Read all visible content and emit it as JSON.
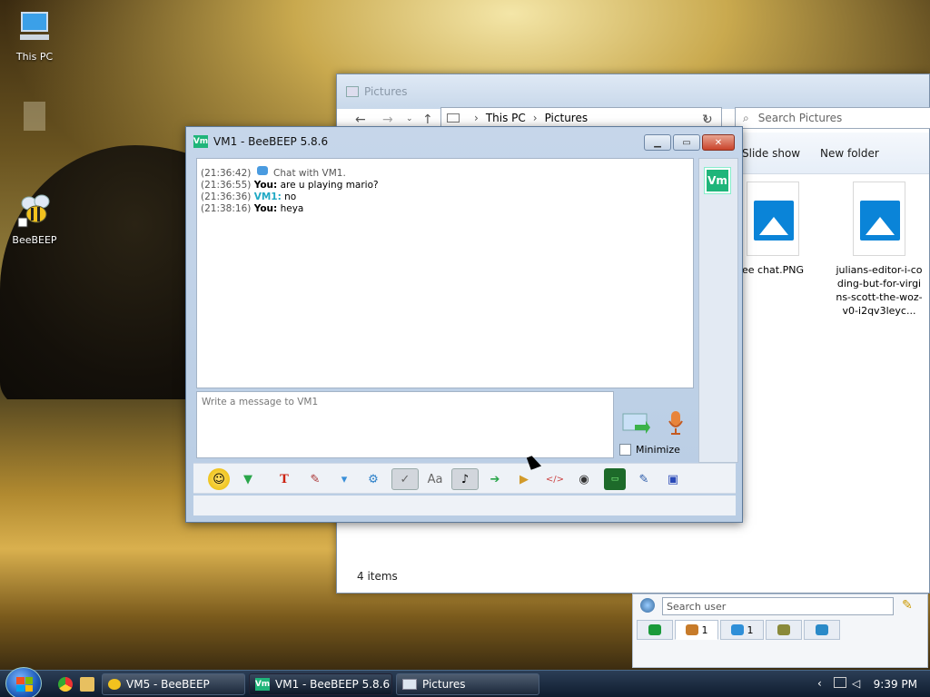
{
  "desktop": {
    "icons": [
      {
        "label": "This PC",
        "icon": "computer-icon"
      },
      {
        "label": "",
        "icon": "folder-icon"
      },
      {
        "label": "BeeBEEP",
        "icon": "bee-icon"
      }
    ]
  },
  "explorer": {
    "title": "Pictures",
    "address": {
      "root": "This PC",
      "current": "Pictures"
    },
    "search_placeholder": "Search Pictures",
    "commands": [
      "Slide show",
      "New folder"
    ],
    "files": [
      {
        "name": "ee chat.PNG"
      },
      {
        "name": "julians-editor-i-coding-but-for-virgins-scott-the-woz-v0-i2qv3leyc..."
      }
    ],
    "status": "4 items"
  },
  "beebeep": {
    "title": "VM1 - BeeBEEP 5.8.6",
    "badge": "Vm",
    "chat": [
      {
        "time": "(21:36:42)",
        "sender": "",
        "text": "Chat with VM1.",
        "system": true
      },
      {
        "time": "(21:36:55)",
        "sender": "You:",
        "text": "are u playing mario?"
      },
      {
        "time": "(21:36:36)",
        "sender": "VM1:",
        "text": "no"
      },
      {
        "time": "(21:38:16)",
        "sender": "You:",
        "text": "heya"
      }
    ],
    "message_placeholder": "Write a message to VM1",
    "minimize_label": "Minimize",
    "toolbar_icons": [
      "emoticon-icon",
      "save-icon",
      "font-icon",
      "color-icon",
      "filter-icon",
      "settings-icon",
      "spellcheck-icon",
      "dictionary-icon",
      "sound-icon",
      "export-icon",
      "send-folder-icon",
      "code-icon",
      "screenshot-icon",
      "shell-icon",
      "notes-icon",
      "save-as-icon"
    ]
  },
  "userlist": {
    "search_placeholder": "Search user",
    "tabs": [
      {
        "icon": "home-icon",
        "count": ""
      },
      {
        "icon": "users-icon",
        "count": "1"
      },
      {
        "icon": "chats-icon",
        "count": "1"
      },
      {
        "icon": "groups-icon",
        "count": ""
      },
      {
        "icon": "network-icon",
        "count": ""
      }
    ]
  },
  "taskbar": {
    "items": [
      {
        "label": "VM5 - BeeBEEP",
        "icon": "bee-icon"
      },
      {
        "label": "VM1 - BeeBEEP 5.8.6",
        "icon": "vm-icon"
      },
      {
        "label": "Pictures",
        "icon": "explorer-icon"
      }
    ],
    "clock": "9:39 PM"
  }
}
